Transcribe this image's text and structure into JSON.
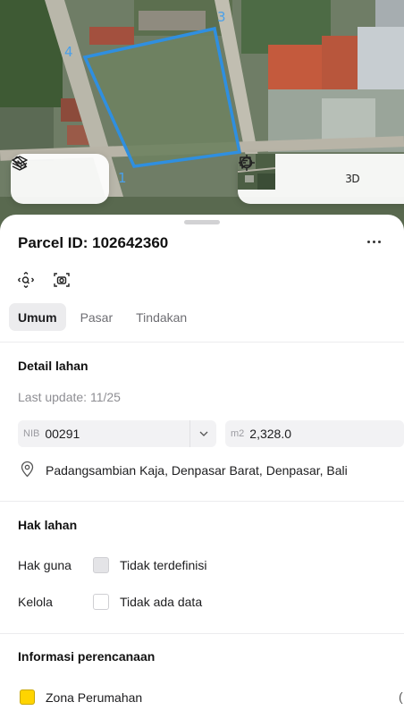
{
  "map": {
    "vertex_labels": [
      "4",
      "3",
      "1"
    ],
    "parcel_color": "#2f8fe0",
    "tools_left": [
      {
        "icon": "layers-icon"
      },
      {
        "icon": "ruler-icon"
      }
    ],
    "tools_right": [
      {
        "icon": "satellite-thumbnail"
      },
      {
        "icon": "crosshair-icon"
      },
      {
        "icon": "3d-toggle",
        "label": "3D"
      },
      {
        "icon": "chat-icon"
      }
    ]
  },
  "sheet": {
    "title": "Parcel ID: 102642360",
    "more_icon": "more-horizontal-icon",
    "action_icons": [
      "zoom-to-parcel-icon",
      "screenshot-icon"
    ],
    "tabs": [
      {
        "label": "Umum",
        "active": true
      },
      {
        "label": "Pasar",
        "active": false
      },
      {
        "label": "Tindakan",
        "active": false
      }
    ],
    "detail": {
      "title": "Detail lahan",
      "last_update": "Last update: 11/25",
      "nib_prefix": "NIB",
      "nib_value": "00291",
      "area_prefix": "m2",
      "area_value": "2,328.0",
      "address": "Padangsambian Kaja, Denpasar Barat, Denpasar, Bali"
    },
    "rights": {
      "title": "Hak lahan",
      "rows": [
        {
          "key": "Hak guna",
          "value": "Tidak terdefinisi"
        },
        {
          "key": "Kelola",
          "value": "Tidak ada data"
        }
      ]
    },
    "planning": {
      "title": "Informasi perencanaan",
      "zone_label": "Zona Perumahan",
      "zone_color": "#ffd400",
      "zone_trailing": "("
    }
  }
}
